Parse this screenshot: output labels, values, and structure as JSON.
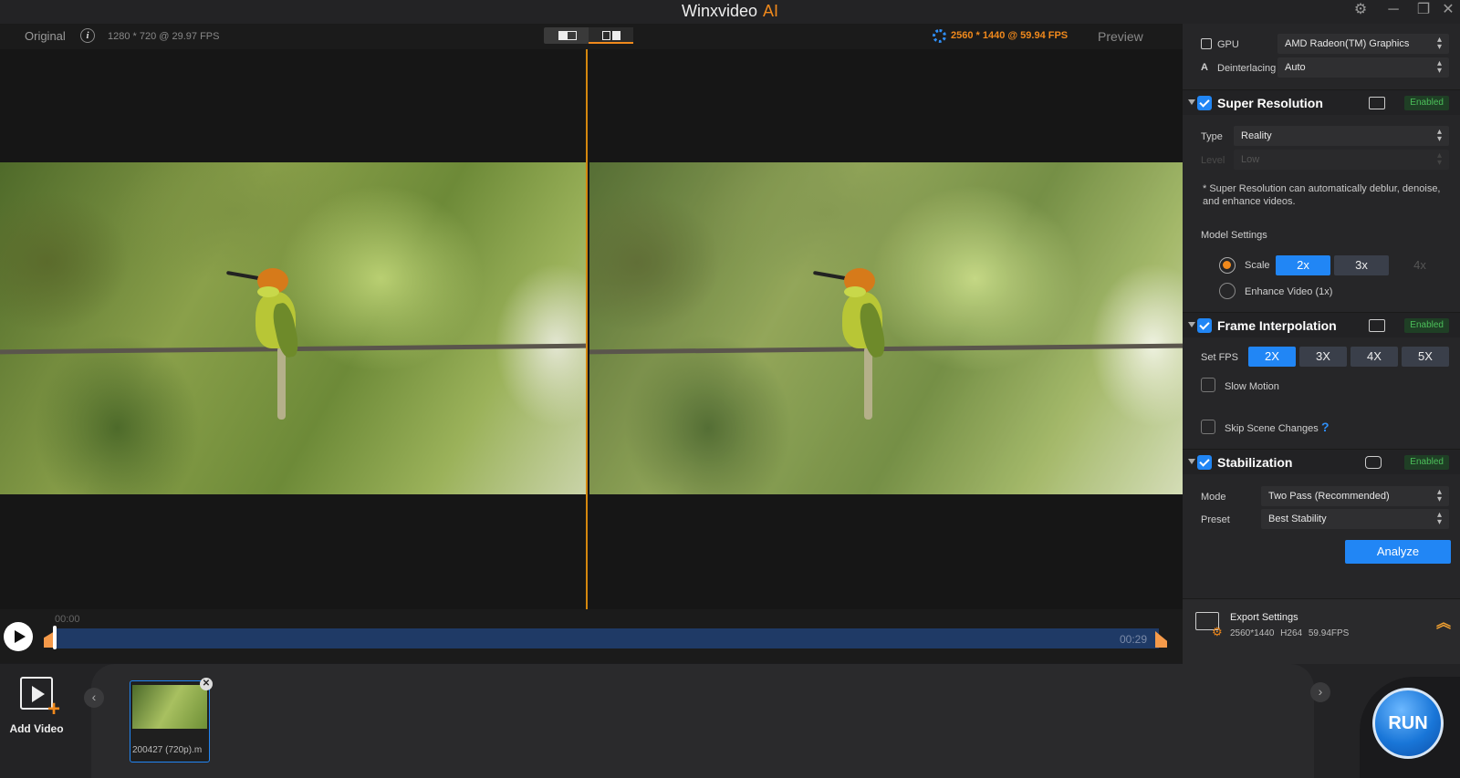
{
  "app": {
    "title": "Winxvideo",
    "title_suffix": "AI"
  },
  "preview": {
    "original_label": "Original",
    "original_res": "1280 * 720 @ 29.97 FPS",
    "preview_res": "2560 * 1440 @ 59.94 FPS",
    "preview_label": "Preview"
  },
  "timeline": {
    "start": "00:00",
    "end": "00:29"
  },
  "panel": {
    "gpu_label": "GPU",
    "gpu_value": "AMD Radeon(TM) Graphics",
    "deint_label": "Deinterlacing",
    "deint_value": "Auto",
    "enabled_badge": "Enabled",
    "sr": {
      "title": "Super Resolution",
      "type_label": "Type",
      "type_value": "Reality",
      "level_label": "Level",
      "level_value": "Low",
      "note": "* Super Resolution can automatically deblur, denoise, and enhance videos.",
      "model_settings": "Model Settings",
      "scale_label": "Scale",
      "scale_options": [
        "2x",
        "3x",
        "4x"
      ],
      "enhance_label": "Enhance Video (1x)"
    },
    "fi": {
      "title": "Frame Interpolation",
      "setfps_label": "Set FPS",
      "fps_options": [
        "2X",
        "3X",
        "4X",
        "5X"
      ],
      "slow_motion": "Slow Motion",
      "skip_scene": "Skip Scene Changes",
      "help": "?"
    },
    "stab": {
      "title": "Stabilization",
      "mode_label": "Mode",
      "mode_value": "Two Pass (Recommended)",
      "preset_label": "Preset",
      "preset_value": "Best Stability",
      "analyze": "Analyze"
    },
    "export": {
      "title": "Export Settings",
      "res": "2560*1440",
      "codec": "H264",
      "fps": "59.94FPS"
    }
  },
  "bottom": {
    "add_video": "Add Video",
    "thumb_label": "200427 (720p).m",
    "run": "RUN"
  }
}
